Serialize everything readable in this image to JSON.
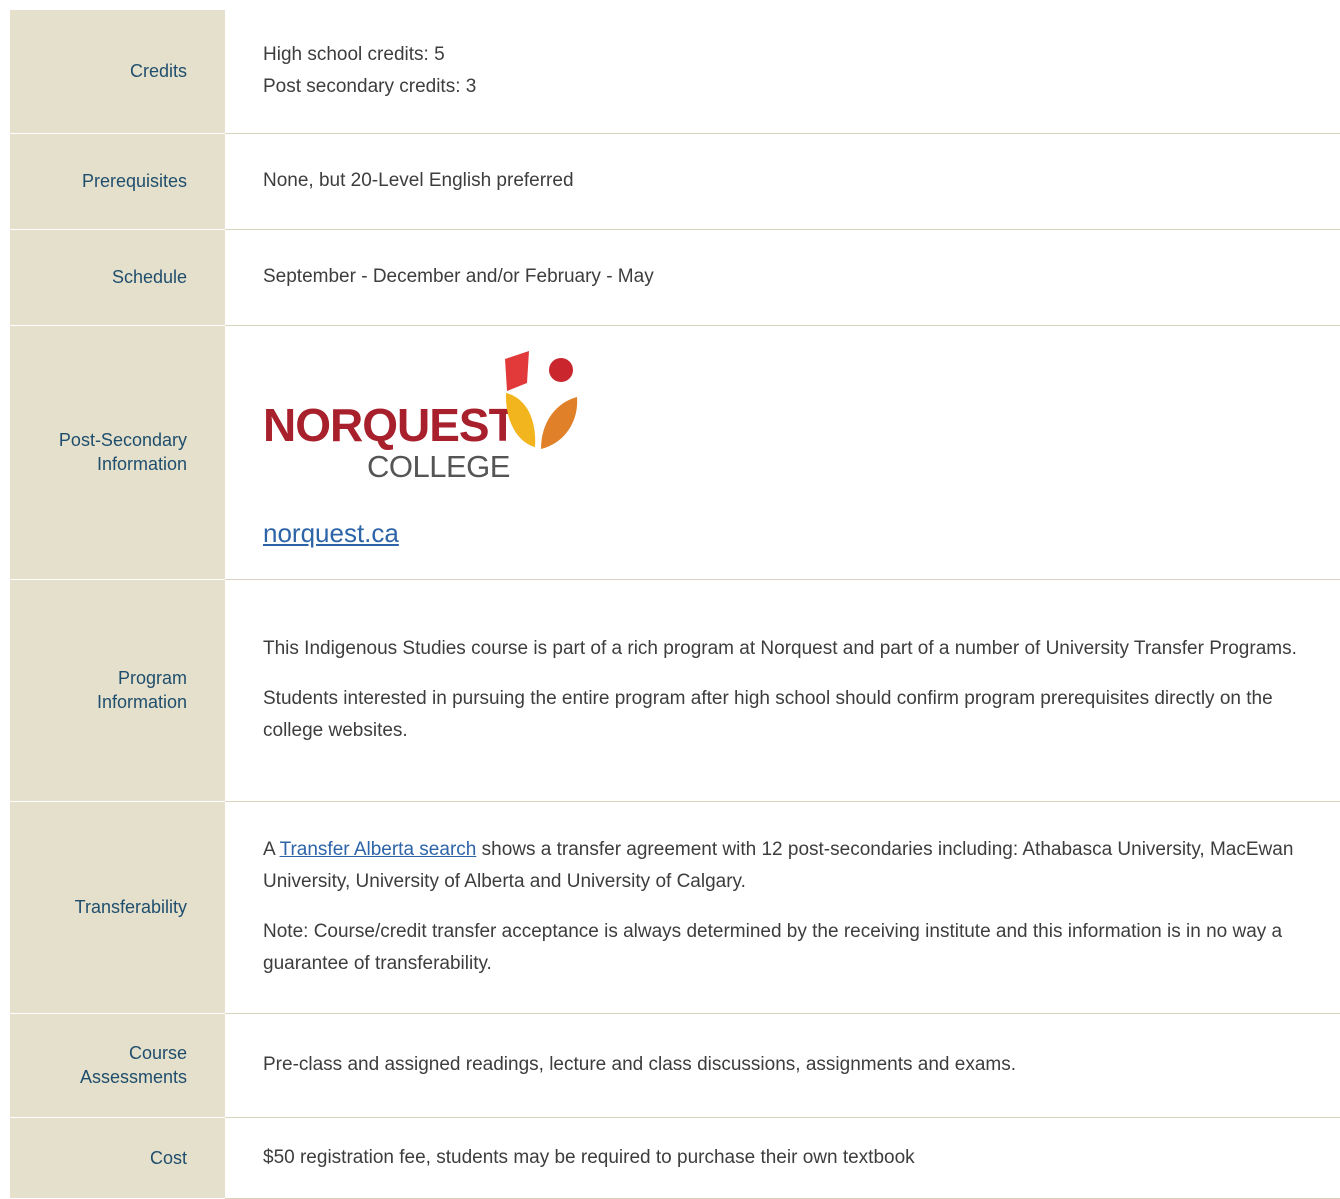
{
  "rows": {
    "credits": {
      "label": "Credits",
      "line1": "High school credits: 5",
      "line2": "Post secondary credits: 3"
    },
    "prerequisites": {
      "label": "Prerequisites",
      "value": "None, but 20-Level English preferred"
    },
    "schedule": {
      "label": "Schedule",
      "value": "September - December and/or February - May"
    },
    "post_secondary": {
      "label_line1": "Post-Secondary",
      "label_line2": "Information",
      "logo_word1": "NORQUEST",
      "logo_word2": "COLLEGE",
      "link_text": "norquest.ca"
    },
    "program": {
      "label_line1": "Program",
      "label_line2": "Information",
      "para1": "This Indigenous Studies course is part of a rich program at Norquest and part of a number of University Transfer Programs.",
      "para2": "Students interested in pursuing the entire program after high school should confirm program prerequisites directly on the college websites."
    },
    "transferability": {
      "label": "Transferability",
      "para1_prefix": "A ",
      "para1_link": "Transfer Alberta search",
      "para1_suffix": " shows a transfer agreement with 12 post-secondaries including: Athabasca University, MacEwan University, University of Alberta and University of Calgary.",
      "para2": "Note: Course/credit transfer acceptance is always determined by the receiving institute and this information is in no way a guarantee of transferability."
    },
    "assessments": {
      "label_line1": "Course",
      "label_line2": "Assessments",
      "value": "Pre-class and assigned readings, lecture and class discussions, assignments and exams."
    },
    "cost": {
      "label": "Cost",
      "value": "$50 registration fee, students may be required to purchase their own textbook"
    }
  },
  "icons": {
    "logo_mark": "norquest-leaf-logo-icon"
  },
  "colors": {
    "label_background": "#e5e0cc",
    "label_text": "#1f4e6d",
    "link": "#2d64a8",
    "logo_red": "#a8202c",
    "logo_orange": "#e0812a",
    "logo_yellow": "#f2b51e"
  }
}
